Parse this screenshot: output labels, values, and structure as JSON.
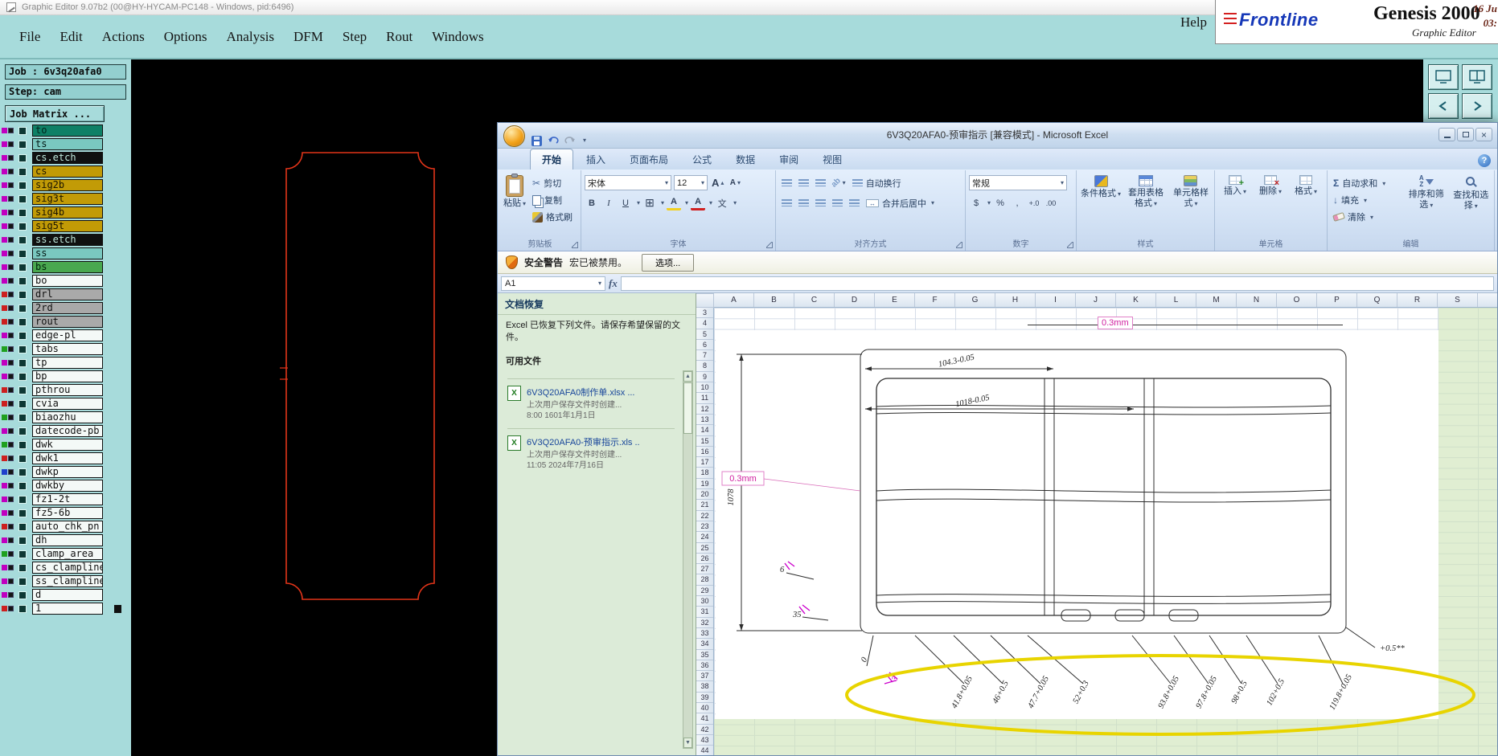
{
  "genesis": {
    "window_title": "Graphic Editor 9.07b2 (00@HY-HYCAM-PC148 - Windows, pid:6496)",
    "menus": [
      "File",
      "Edit",
      "Actions",
      "Options",
      "Analysis",
      "DFM",
      "Step",
      "Rout",
      "Windows"
    ],
    "help": "Help",
    "brand": {
      "name": "Frontline",
      "product": "Genesis 2000",
      "edition": "Graphic Editor",
      "clock_line1": "16 Ju",
      "clock_line2": "03:"
    },
    "job": {
      "job": "Job : 6v3q20afa0",
      "step": "Step: cam",
      "matrix": "Job Matrix ..."
    },
    "layers": [
      {
        "name": "to",
        "bg": "#0e8066",
        "fg": "#00241c",
        "chip": "#c000c0"
      },
      {
        "name": "ts",
        "bg": "#7ac8c0",
        "fg": "#041a16",
        "chip": "#c000c0"
      },
      {
        "name": "cs.etch",
        "bg": "#101010",
        "fg": "#bfe8dc",
        "chip": "#c000c0"
      },
      {
        "name": "cs",
        "bg": "#c29b06",
        "fg": "#1a1400",
        "chip": "#c000c0"
      },
      {
        "name": "sig2b",
        "bg": "#c29b06",
        "fg": "#1a1400",
        "chip": "#c000c0"
      },
      {
        "name": "sig3t",
        "bg": "#c29b06",
        "fg": "#1a1400",
        "chip": "#c000c0"
      },
      {
        "name": "sig4b",
        "bg": "#c29b06",
        "fg": "#1a1400",
        "chip": "#c000c0"
      },
      {
        "name": "sig5t",
        "bg": "#c29b06",
        "fg": "#1a1400",
        "chip": "#c000c0"
      },
      {
        "name": "ss.etch",
        "bg": "#101010",
        "fg": "#bfe8dc",
        "chip": "#c000c0"
      },
      {
        "name": "ss",
        "bg": "#7ac8c0",
        "fg": "#041a16",
        "chip": "#c000c0"
      },
      {
        "name": "bs",
        "bg": "#49a84f",
        "fg": "#00220a",
        "chip": "#c000c0"
      },
      {
        "name": "bo",
        "bg": "#f4f9f7",
        "fg": "#101010",
        "chip": "#c000c0"
      },
      {
        "name": "drl",
        "bg": "#a9a9a9",
        "fg": "#101010",
        "chip": "#cc2020"
      },
      {
        "name": "2rd",
        "bg": "#a9a9a9",
        "fg": "#101010",
        "chip": "#cc2020"
      },
      {
        "name": "rout",
        "bg": "#a9a9a9",
        "fg": "#101010",
        "chip": "#cc2020"
      },
      {
        "name": "edge-pl",
        "bg": "#f4f9f7",
        "fg": "#101010",
        "chip": "#c000c0"
      },
      {
        "name": "tabs",
        "bg": "#f4f9f7",
        "fg": "#101010",
        "chip": "#20a020"
      },
      {
        "name": "tp",
        "bg": "#f4f9f7",
        "fg": "#101010",
        "chip": "#c000c0"
      },
      {
        "name": "bp",
        "bg": "#f4f9f7",
        "fg": "#101010",
        "chip": "#c000c0"
      },
      {
        "name": "pthrou",
        "bg": "#f4f9f7",
        "fg": "#101010",
        "chip": "#cc2020"
      },
      {
        "name": "cvia",
        "bg": "#f4f9f7",
        "fg": "#101010",
        "chip": "#cc2020"
      },
      {
        "name": "biaozhu",
        "bg": "#f4f9f7",
        "fg": "#101010",
        "chip": "#20a020"
      },
      {
        "name": "datecode-pb",
        "bg": "#f4f9f7",
        "fg": "#101010",
        "chip": "#c000c0"
      },
      {
        "name": "dwk",
        "bg": "#f4f9f7",
        "fg": "#101010",
        "chip": "#20a020"
      },
      {
        "name": "dwk1",
        "bg": "#f4f9f7",
        "fg": "#101010",
        "chip": "#cc2020"
      },
      {
        "name": "dwkp",
        "bg": "#f4f9f7",
        "fg": "#101010",
        "chip": "#2040cc"
      },
      {
        "name": "dwkby",
        "bg": "#f4f9f7",
        "fg": "#101010",
        "chip": "#c000c0"
      },
      {
        "name": "fz1-2t",
        "bg": "#f4f9f7",
        "fg": "#101010",
        "chip": "#c000c0"
      },
      {
        "name": "fz5-6b",
        "bg": "#f4f9f7",
        "fg": "#101010",
        "chip": "#c000c0"
      },
      {
        "name": "auto_chk_pn",
        "bg": "#f4f9f7",
        "fg": "#101010",
        "chip": "#cc2020"
      },
      {
        "name": "dh",
        "bg": "#f4f9f7",
        "fg": "#101010",
        "chip": "#c000c0"
      },
      {
        "name": "clamp_area",
        "bg": "#f4f9f7",
        "fg": "#101010",
        "chip": "#20a020"
      },
      {
        "name": "cs_clampline",
        "bg": "#f4f9f7",
        "fg": "#101010",
        "chip": "#c000c0"
      },
      {
        "name": "ss_clampline",
        "bg": "#f4f9f7",
        "fg": "#101010",
        "chip": "#c000c0"
      },
      {
        "name": "d",
        "bg": "#f4f9f7",
        "fg": "#101010",
        "chip": "#c000c0"
      },
      {
        "name": "1",
        "bg": "#f4f9f7",
        "fg": "#101010",
        "chip": "#cc2020"
      }
    ],
    "outline_color": "#e23419",
    "sidebar_color": "#a7dbdb"
  },
  "excel": {
    "title": "6V3Q20AFA0-预审指示  [兼容模式] - Microsoft Excel",
    "tabs": [
      "开始",
      "插入",
      "页面布局",
      "公式",
      "数据",
      "审阅",
      "视图"
    ],
    "ribbon": {
      "clipboard": {
        "label": "剪贴板",
        "paste": "粘贴",
        "cut": "剪切",
        "copy": "复制",
        "painter": "格式刷"
      },
      "font": {
        "label": "字体",
        "family": "宋体",
        "size": "12"
      },
      "align": {
        "label": "对齐方式",
        "wrap": "自动换行",
        "merge": "合并后居中"
      },
      "number": {
        "label": "数字",
        "format": "常规"
      },
      "styles": {
        "label": "样式",
        "conditional": "条件格式",
        "table": "套用表格格式",
        "cell": "单元格样式"
      },
      "cells": {
        "label": "单元格",
        "insert": "插入",
        "delete": "删除",
        "format": "格式"
      },
      "editing": {
        "label": "编辑",
        "autosum": "自动求和",
        "fill": "填充",
        "clear": "清除",
        "sort": "排序和筛选",
        "find": "查找和选择"
      }
    },
    "glyphs": {
      "dropdown": "▾",
      "tri_up": "▴",
      "cut": "✂",
      "borders": "⊞",
      "bold": "B",
      "italic": "I",
      "underline": "U",
      "letter_a": "A",
      "phonetic": "文",
      "orientation": "ab",
      "currency": "$",
      "percent": "%",
      "comma": ",",
      "inc_decimal": "+.0",
      "dec_decimal": ".00",
      "sigma": "Σ",
      "help": "?",
      "fx": "fx",
      "fill_down": "↓",
      "sort_a": "A",
      "sort_z": "Z",
      "up": "▲",
      "down": "▼",
      "min": "—",
      "max": "□",
      "close": "×"
    },
    "security": {
      "label": "安全警告",
      "message": "宏已被禁用。",
      "options": "选项..."
    },
    "name_box": "A1",
    "columns": [
      "A",
      "B",
      "C",
      "D",
      "E",
      "F",
      "G",
      "H",
      "I",
      "J",
      "K",
      "L",
      "M",
      "N",
      "O",
      "P",
      "Q",
      "R",
      "S"
    ],
    "rows": [
      "3",
      "4",
      "5",
      "6",
      "7",
      "8",
      "9",
      "10",
      "11",
      "12",
      "13",
      "14",
      "15",
      "16",
      "17",
      "18",
      "19",
      "20",
      "21",
      "22",
      "23",
      "24",
      "25",
      "26",
      "27",
      "28",
      "29",
      "30",
      "31",
      "32",
      "33",
      "34",
      "35",
      "36",
      "37",
      "38",
      "39",
      "40",
      "41",
      "42",
      "43",
      "44"
    ],
    "recovery": {
      "title": "文档恢复",
      "intro": "Excel 已恢复下列文件。请保存希望保留的文件。",
      "available": "可用文件",
      "files": [
        {
          "name": "6V3Q20AFA0制作单.xlsx ...",
          "desc": "上次用户保存文件时创建...",
          "time": "8:00 1601年1月1日"
        },
        {
          "name": "6V3Q20AFA0-预审指示.xls ..",
          "desc": "上次用户保存文件时创建...",
          "time": "11:05 2024年7月16日"
        }
      ]
    },
    "drawing": {
      "top_dim1": "104.3-0.05",
      "top_dim2": "1018-0.05",
      "left_dim": "1078",
      "left_badge": "0.3mm",
      "top_badge": "0.3mm",
      "note": "+0.5**",
      "small_dim_6": "6",
      "small_dim_35": "35",
      "small_dim_0": "0",
      "check_mark": "3",
      "bottom_dims": [
        "41.8+0.05",
        "46+0.5",
        "47.7+0.05",
        "52+0.3",
        "93.8+0.05",
        "97.8+0.05",
        "98+0.5",
        "102+0.5",
        "119.8+0.05"
      ],
      "highlight_color": "#e8d400"
    }
  }
}
